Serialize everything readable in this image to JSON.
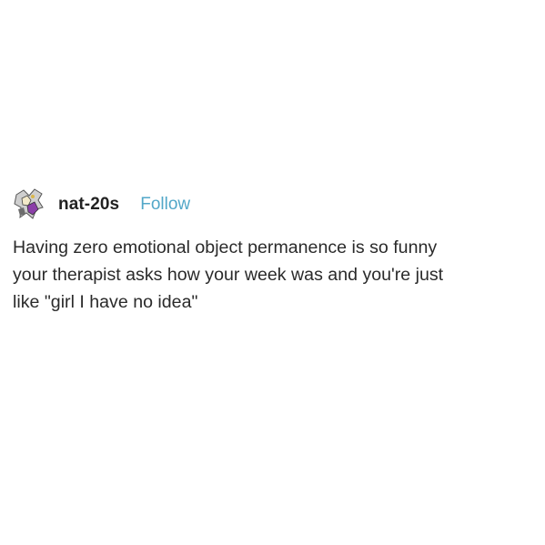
{
  "post": {
    "username": "nat-20s",
    "follow_label": "Follow",
    "avatar_icon": "blog-avatar-icon",
    "lines": [
      "Having zero emotional object permanence is so funny",
      "your therapist asks how your week was and you're just",
      "like \"girl I have no idea\""
    ]
  },
  "colors": {
    "follow": "#52a7c8",
    "text": "#222222",
    "background": "#ffffff"
  }
}
